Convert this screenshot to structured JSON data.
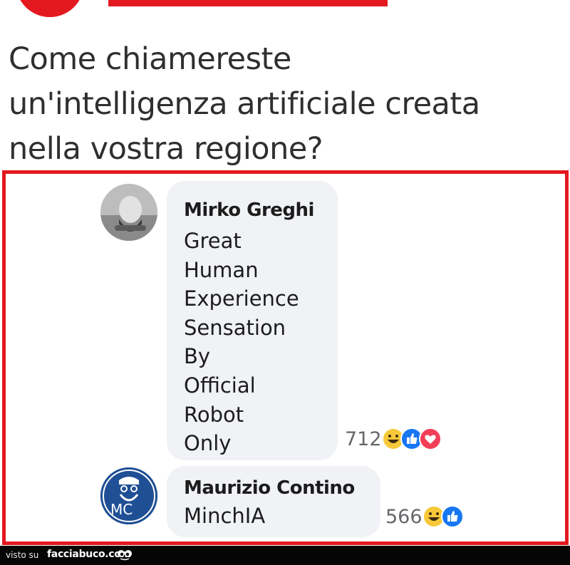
{
  "header": {
    "question_lines": [
      "Come chiamereste",
      "un'intelligenza artificiale creata",
      "nella vostra regione?"
    ]
  },
  "comments": [
    {
      "author": "Mirko Greghi",
      "text_lines": [
        "Great",
        "Human",
        "Experience",
        "Sensation",
        "By",
        "Official",
        "Robot",
        "Only"
      ],
      "reaction_count": "712",
      "reactions": [
        "haha-icon",
        "like-icon",
        "love-icon"
      ]
    },
    {
      "author": "Maurizio Contino",
      "text": "MinchIA",
      "reaction_count": "566",
      "reactions": [
        "haha-icon",
        "like-icon"
      ],
      "avatar_initials": "MC"
    }
  ],
  "footer": {
    "visto_su": "visto su",
    "site": "facciabuco.com"
  },
  "colors": {
    "frame": "#e3191f",
    "bubble": "#f0f2f5",
    "like": "#1877f2",
    "love": "#f33e58",
    "haha": "#f7c93a"
  }
}
